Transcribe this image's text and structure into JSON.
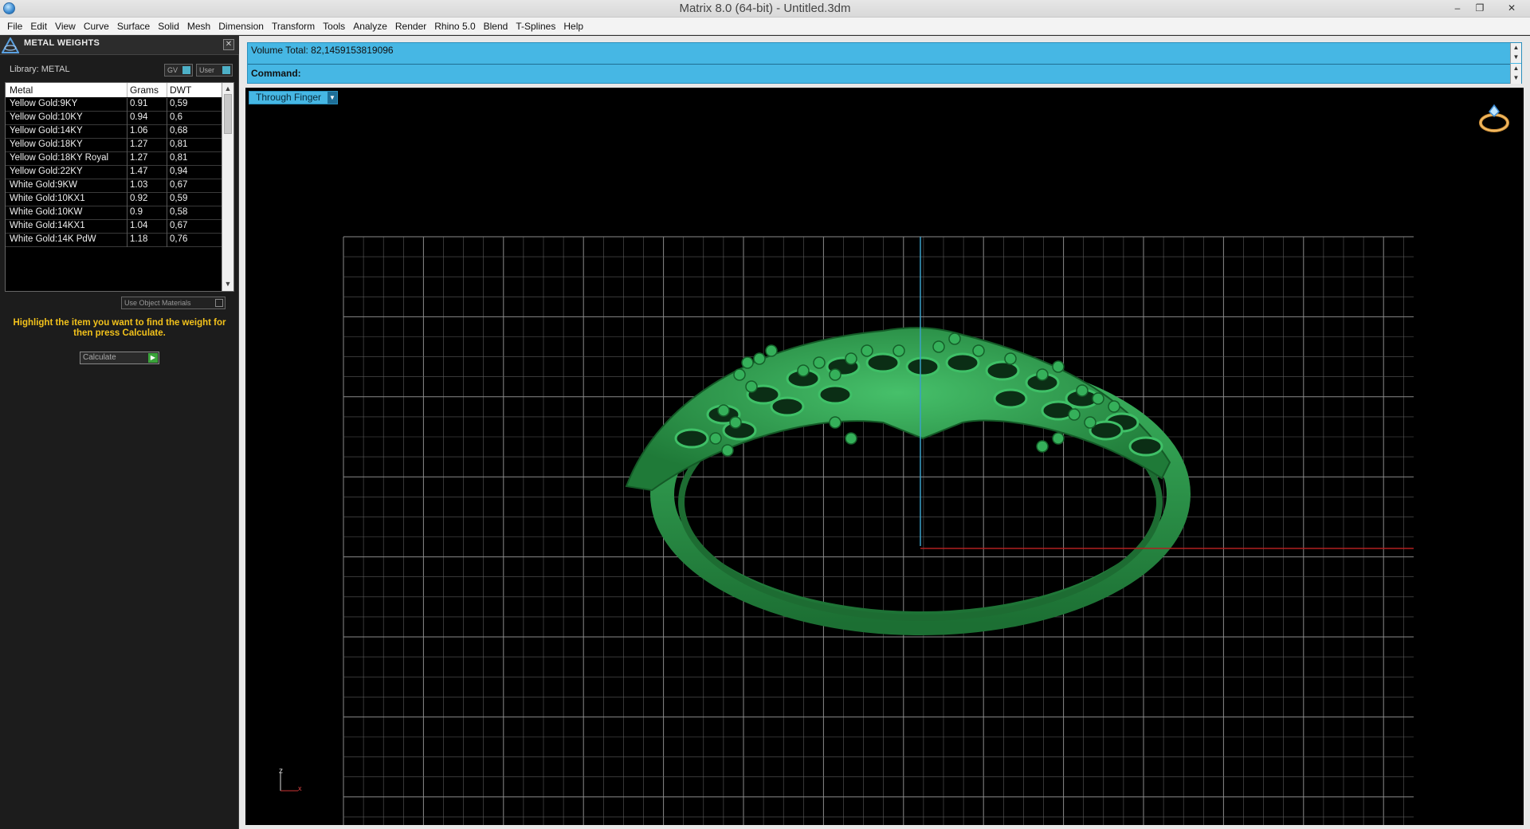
{
  "window": {
    "title": "Matrix 8.0 (64-bit) - Untitled.3dm",
    "minimize": "–",
    "maximize": "❐",
    "close": "✕"
  },
  "menu": [
    "File",
    "Edit",
    "View",
    "Curve",
    "Surface",
    "Solid",
    "Mesh",
    "Dimension",
    "Transform",
    "Tools",
    "Analyze",
    "Render",
    "Rhino 5.0",
    "Blend",
    "T-Splines",
    "Help"
  ],
  "panel": {
    "title": "METAL WEIGHTS",
    "close": "✕",
    "library_label": "Library: METAL",
    "toggle_gv": "GV",
    "toggle_user": "User",
    "columns": [
      "Metal",
      "Grams",
      "DWT"
    ],
    "rows": [
      [
        "Yellow Gold:9KY",
        "0.91",
        "0,59"
      ],
      [
        "Yellow Gold:10KY",
        "0.94",
        "0,6"
      ],
      [
        "Yellow Gold:14KY",
        "1.06",
        "0,68"
      ],
      [
        "Yellow Gold:18KY",
        "1.27",
        "0,81"
      ],
      [
        "Yellow Gold:18KY Royal",
        "1.27",
        "0,81"
      ],
      [
        "Yellow Gold:22KY",
        "1.47",
        "0,94"
      ],
      [
        "White Gold:9KW",
        "1.03",
        "0,67"
      ],
      [
        "White Gold:10KX1",
        "0.92",
        "0,59"
      ],
      [
        "White Gold:10KW",
        "0.9",
        "0,58"
      ],
      [
        "White Gold:14KX1",
        "1.04",
        "0,67"
      ],
      [
        "White Gold:14K PdW",
        "1.18",
        "0,76"
      ]
    ],
    "use_object_materials": "Use Object Materials",
    "hint": "Highlight the item you want to find the weight for then press Calculate.",
    "calculate": "Calculate"
  },
  "command": {
    "volume": "Volume Total: 82,1459153819096",
    "label": "Command:"
  },
  "viewport": {
    "view_name": "Through Finger",
    "axis_z": "z",
    "axis_x": "x",
    "model_color": "#2f9a4d",
    "grid_color": "#5a5a5a",
    "x_axis_color": "#b02020",
    "y_axis_color": "#3aa0c8"
  }
}
